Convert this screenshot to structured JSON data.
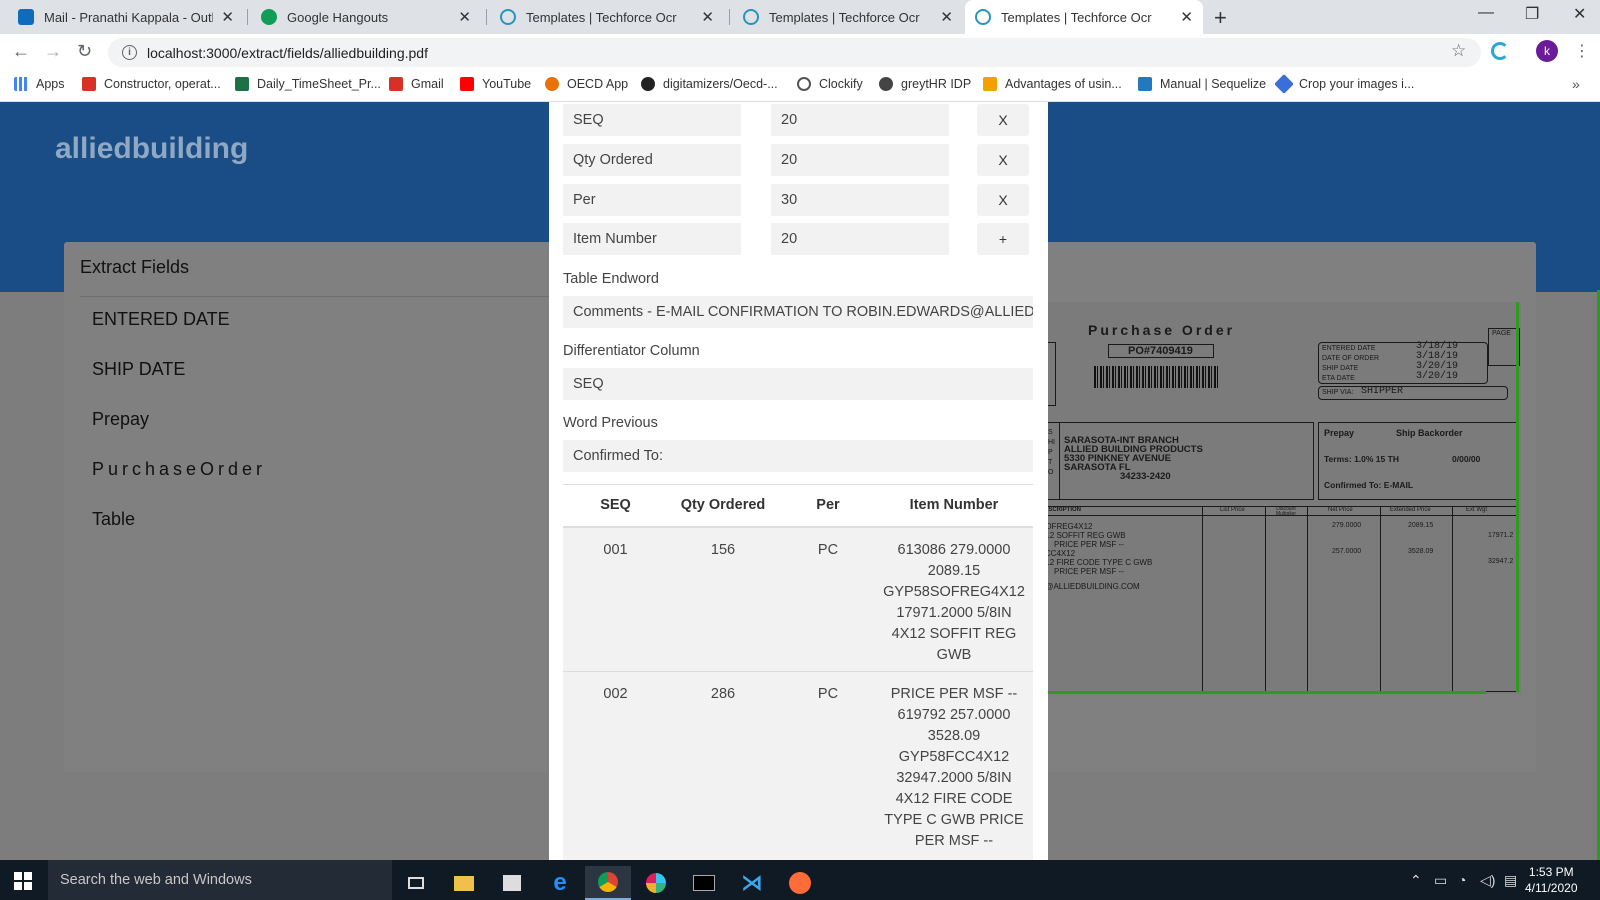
{
  "browser": {
    "tabs": [
      {
        "label": "Mail - Pranathi Kappala - Outlook",
        "icon": "outlook-icon",
        "color": "#0f6cbd"
      },
      {
        "label": "Google Hangouts",
        "icon": "hangouts-icon",
        "color": "#0f9d58"
      },
      {
        "label": "Templates | Techforce Ocr",
        "icon": "react-icon",
        "color": "#2496bd"
      },
      {
        "label": "Templates | Techforce Ocr",
        "icon": "react-icon",
        "color": "#2496bd"
      },
      {
        "label": "Templates | Techforce Ocr",
        "icon": "react-icon",
        "color": "#2496bd"
      }
    ],
    "url": "localhost:3000/extract/fields/alliedbuilding.pdf",
    "profile_initial": "k",
    "bookmarks": [
      {
        "label": "Apps",
        "icon": "apps-grid-icon",
        "color": "#4285f4"
      },
      {
        "label": "Constructor, operat...",
        "icon": "figure-icon",
        "color": "#d93025"
      },
      {
        "label": "Daily_TimeSheet_Pr...",
        "icon": "excel-icon",
        "color": "#1e7145"
      },
      {
        "label": "Gmail",
        "icon": "gmail-icon",
        "color": "#d93025"
      },
      {
        "label": "YouTube",
        "icon": "youtube-icon",
        "color": "#ff0000"
      },
      {
        "label": "OECD App",
        "icon": "oecd-icon",
        "color": "#e8710a"
      },
      {
        "label": "digitamizers/Oecd-...",
        "icon": "github-icon",
        "color": "#222222"
      },
      {
        "label": "Clockify",
        "icon": "clockify-icon",
        "color": "#555555"
      },
      {
        "label": "greytHR IDP",
        "icon": "greythr-icon",
        "color": "#444444"
      },
      {
        "label": "Advantages of usin...",
        "icon": "bookmark-icon",
        "color": "#f4a100"
      },
      {
        "label": "Manual | Sequelize",
        "icon": "sequelize-icon",
        "color": "#2379bd"
      },
      {
        "label": "Crop your images i...",
        "icon": "crop-icon",
        "color": "#3a6fd8"
      }
    ]
  },
  "app": {
    "brand": "alliedbuilding",
    "card_title": "Extract Fields",
    "fields": [
      "ENTERED DATE",
      "SHIP DATE",
      "Prepay",
      "PurchaseOrder",
      "Table"
    ]
  },
  "modal": {
    "column_rows": [
      {
        "key": "SEQ",
        "value": "20",
        "button": "X"
      },
      {
        "key": "Qty Ordered",
        "value": "20",
        "button": "X"
      },
      {
        "key": "Per",
        "value": "30",
        "button": "X"
      },
      {
        "key": "Item Number",
        "value": "20",
        "button": "+"
      }
    ],
    "table_endword_label": "Table Endword",
    "table_endword_value": "Comments - E-MAIL CONFIRMATION TO ROBIN.EDWARDS@ALLIEDBU",
    "differentiator_label": "Differentiator Column",
    "differentiator_value": "SEQ",
    "word_previous_label": "Word Previous",
    "word_previous_value": "Confirmed To:",
    "table": {
      "headers": [
        "SEQ",
        "Qty Ordered",
        "Per",
        "Item Number"
      ],
      "rows": [
        {
          "seq": "001",
          "qty": "156",
          "per": "PC",
          "item_lines": [
            "613086 279.0000",
            "2089.15",
            "GYP58SOFREG4X12",
            "17971.2000 5/8IN",
            "4X12 SOFFIT REG",
            "GWB"
          ]
        },
        {
          "seq": "002",
          "qty": "286",
          "per": "PC",
          "item_lines": [
            "PRICE PER MSF --",
            "619792 257.0000",
            "3528.09",
            "GYP58FCC4X12",
            "32947.2000 5/8IN",
            "4X12 FIRE CODE",
            "TYPE C GWB PRICE",
            "PER MSF --"
          ]
        }
      ]
    }
  },
  "pdf_preview": {
    "title": "Purchase Order",
    "po_number": "PO#7409419",
    "page_label": "PAGE",
    "date_labels": [
      "ENTERED DATE",
      "DATE OF ORDER",
      "SHIP DATE",
      "ETA DATE"
    ],
    "date_values": [
      "3/18/19",
      "3/18/19",
      "3/20/19",
      "3/20/19"
    ],
    "ship_via_label": "SHIP VIA:",
    "ship_via_value": "SHIPPER",
    "ship_to_letters": "SHIP TO",
    "address_lines": [
      "SARASOTA-INT BRANCH",
      "ALLIED BUILDING PRODUCTS",
      "5330 PINKNEY AVENUE",
      "SARASOTA        FL",
      "34233-2420"
    ],
    "prepay": "Prepay",
    "ship_backorder": "Ship Backorder",
    "terms": "Terms:  1.0%  15 TH",
    "terms_date": "0/00/00",
    "confirmed_to": "Confirmed To: E-MAIL",
    "col_headers": [
      "DESCRIPTION",
      "List Price",
      "Discount Multiplier",
      "Net Price",
      "Extended Price",
      "Ext Wgt"
    ],
    "desc_lines": [
      "SOFREG4X12",
      "X12 SOFFIT REG GWB",
      "PRICE PER MSF --",
      "FCC4X12",
      "X12 FIRE CODE TYPE C GWB",
      "PRICE PER MSF --",
      "S@ALLIEDBUILDING.COM"
    ],
    "net_prices": [
      "279.0000",
      "257.0000"
    ],
    "ext_prices": [
      "2089.15",
      "3528.09"
    ],
    "ext_wgts": [
      "17971.2",
      "32947.2"
    ]
  },
  "taskbar": {
    "search_placeholder": "Search the web and Windows",
    "time": "1:53 PM",
    "date": "4/11/2020"
  }
}
